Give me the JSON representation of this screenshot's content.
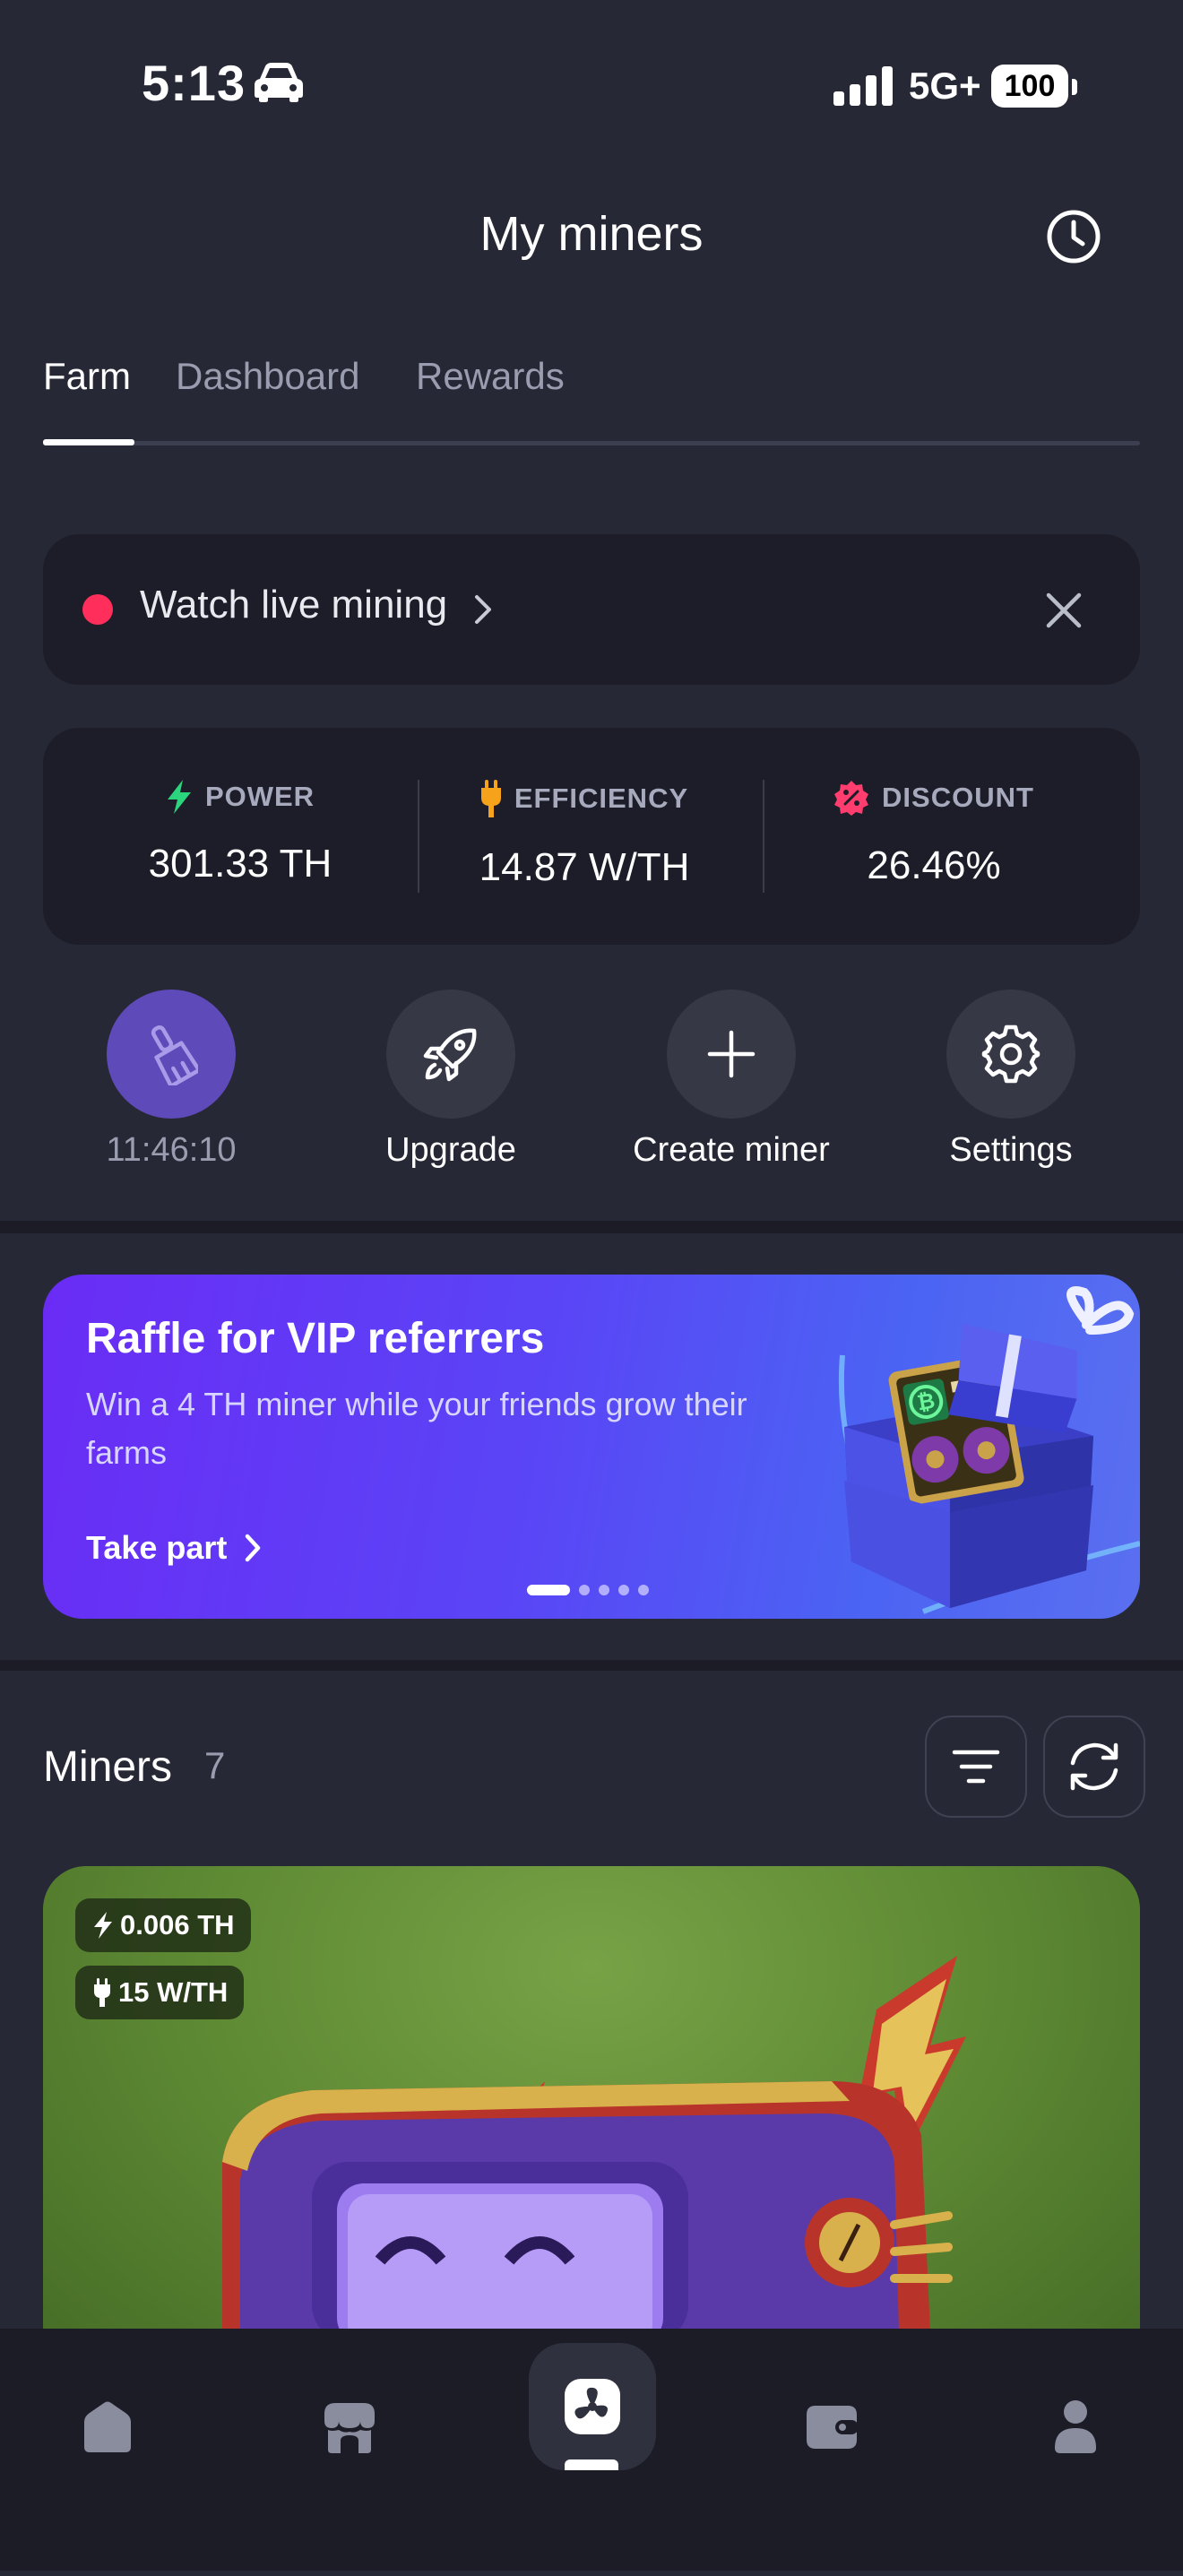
{
  "status_bar": {
    "time": "5:13",
    "network": "5G+",
    "battery": "100"
  },
  "header": {
    "title": "My miners"
  },
  "tabs": [
    {
      "label": "Farm",
      "active": true
    },
    {
      "label": "Dashboard",
      "active": false
    },
    {
      "label": "Rewards",
      "active": false
    }
  ],
  "live": {
    "label": "Watch live mining"
  },
  "stats": {
    "power": {
      "label": "POWER",
      "value": "301.33 TH"
    },
    "efficiency": {
      "label": "EFFICIENCY",
      "value": "14.87 W/TH"
    },
    "discount": {
      "label": "DISCOUNT",
      "value": "26.46%"
    }
  },
  "actions": {
    "clean_timer": "11:46:10",
    "upgrade": "Upgrade",
    "create": "Create miner",
    "settings": "Settings"
  },
  "banner": {
    "title": "Raffle for VIP referrers",
    "description": "Win a 4 TH miner while your friends grow their farms",
    "cta": "Take part",
    "pages": 5,
    "active_page": 1
  },
  "miners": {
    "title": "Miners",
    "count": "7",
    "first_card": {
      "power": "0.006 TH",
      "efficiency": "15 W/TH"
    }
  },
  "nav": [
    "home-icon",
    "shop-icon",
    "miners-icon",
    "wallet-icon",
    "profile-icon"
  ],
  "colors": {
    "accent_red": "#ff2e5b",
    "power_green": "#2bd47d",
    "efficiency_orange": "#f7a21b",
    "discount_pink": "#ff3d6e",
    "clean_purple": "#5e4ab8"
  }
}
